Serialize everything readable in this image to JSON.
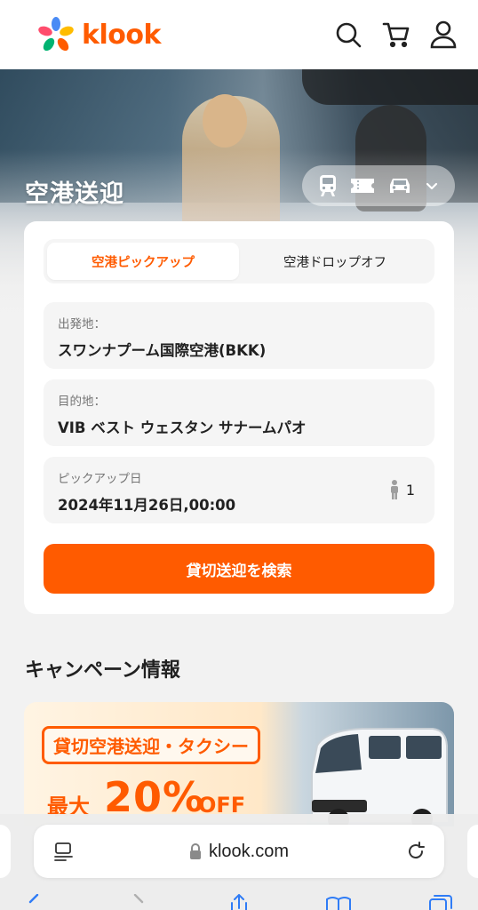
{
  "header": {
    "logo_text": "klook",
    "brand_color": "#ff5b00",
    "icons": [
      "search-icon",
      "cart-icon",
      "user-icon"
    ]
  },
  "hero": {
    "title": "空港送迎",
    "vehicle_icons": [
      "train-icon",
      "ticket-icon",
      "car-icon",
      "chevron-down-icon"
    ]
  },
  "search_card": {
    "tabs": [
      {
        "label": "空港ピックアップ",
        "active": true
      },
      {
        "label": "空港ドロップオフ",
        "active": false
      }
    ],
    "from": {
      "label": "出発地：",
      "value": "スワンナプーム国際空港(BKK)"
    },
    "to": {
      "label": "目的地：",
      "value": "VIB ベスト ウェスタン サナームパオ"
    },
    "date": {
      "label": "ピックアップ日",
      "value": "2024年11月26日,00:00"
    },
    "passengers": "1",
    "search_button": "貸切送迎を検索"
  },
  "campaign": {
    "title": "キャンペーン情報",
    "banner": {
      "headline": "貸切空港送迎・タクシー",
      "max": "最大",
      "percent": "20%",
      "off": "OFF"
    }
  },
  "browser": {
    "url": "klook.com",
    "icons": [
      "tabs-icon",
      "lock-icon",
      "reload-icon",
      "back-icon",
      "forward-icon",
      "share-icon",
      "bookmarks-icon",
      "tab-overview-icon"
    ]
  }
}
